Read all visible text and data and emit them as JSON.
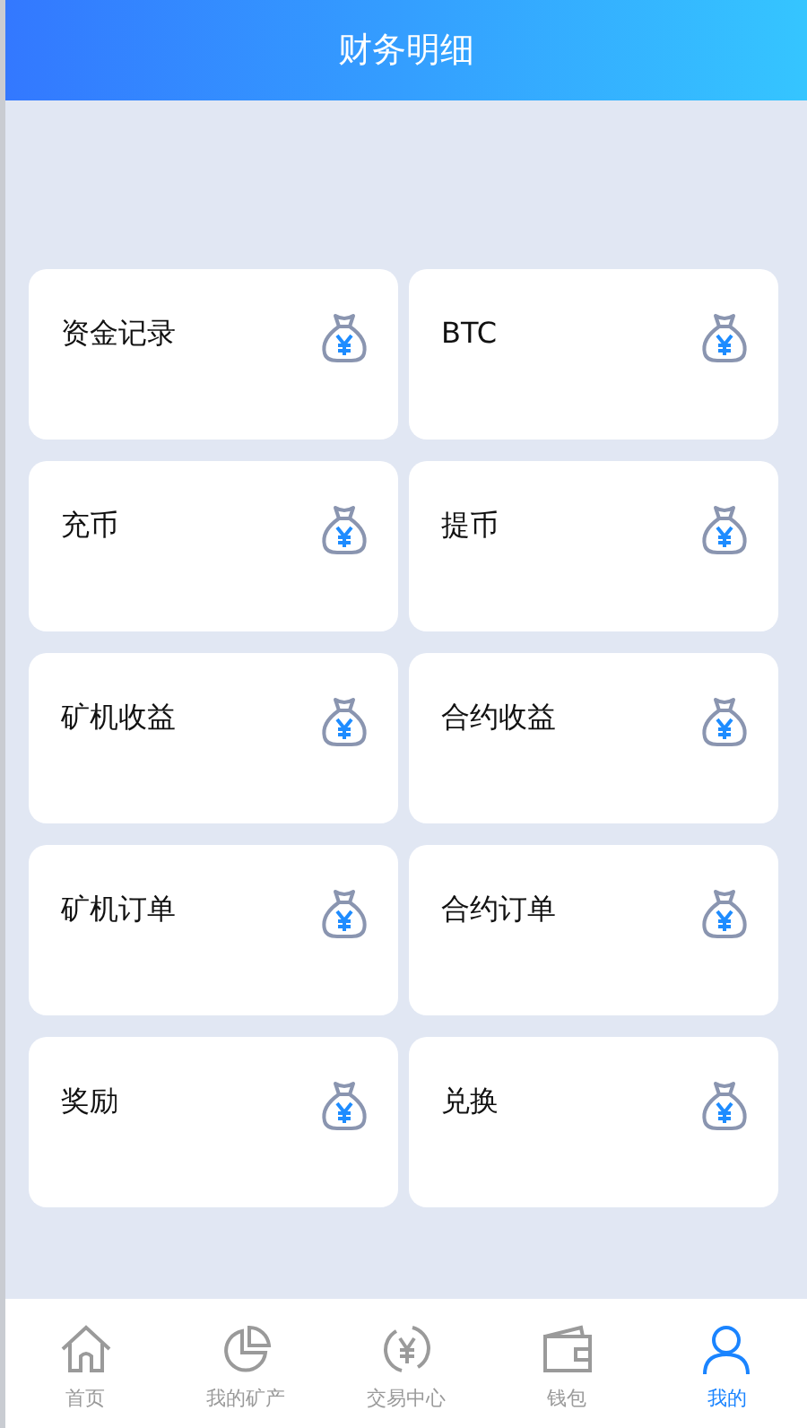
{
  "header": {
    "title": "财务明细"
  },
  "cards": [
    {
      "label": "资金记录"
    },
    {
      "label": "BTC"
    },
    {
      "label": "充币"
    },
    {
      "label": "提币"
    },
    {
      "label": "矿机收益"
    },
    {
      "label": "合约收益"
    },
    {
      "label": "矿机订单"
    },
    {
      "label": "合约订单"
    },
    {
      "label": "奖励"
    },
    {
      "label": "兑换"
    }
  ],
  "tabbar": [
    {
      "label": "首页",
      "kind": "home",
      "selected": false
    },
    {
      "label": "我的矿产",
      "kind": "pie",
      "selected": false
    },
    {
      "label": "交易中心",
      "kind": "exchange",
      "selected": false
    },
    {
      "label": "钱包",
      "kind": "wallet",
      "selected": false
    },
    {
      "label": "我的",
      "kind": "user",
      "selected": true
    }
  ]
}
